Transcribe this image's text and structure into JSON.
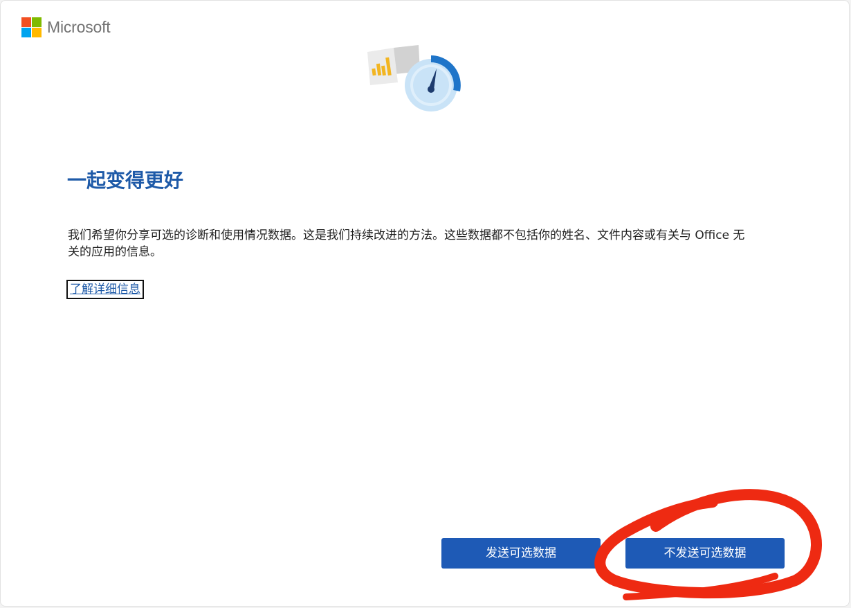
{
  "brand": {
    "name": "Microsoft",
    "logo_colors": [
      "#f25022",
      "#7fba00",
      "#00a4ef",
      "#ffb900"
    ]
  },
  "hero": {
    "icon": "diagnostics-gauge-illustration",
    "colors": {
      "doc_back": "#d2d2d2",
      "doc_front": "#ebebeb",
      "bars": "#f2b521",
      "gauge_face": "#c9e3f7",
      "gauge_ring": "#1f75c9",
      "needle": "#1e3c6e"
    }
  },
  "content": {
    "title": "一起变得更好",
    "body": "我们希望你分享可选的诊断和使用情况数据。这是我们持续改进的方法。这些数据都不包括你的姓名、文件内容或有关与 Office 无关的应用的信息。",
    "learn_more": "了解详细信息"
  },
  "actions": {
    "send": "发送可选数据",
    "dont_send": "不发送可选数据"
  },
  "annotation": {
    "color": "#ee2a12"
  },
  "colors": {
    "accent": "#1e5aa8",
    "button": "#1e5ab6"
  }
}
